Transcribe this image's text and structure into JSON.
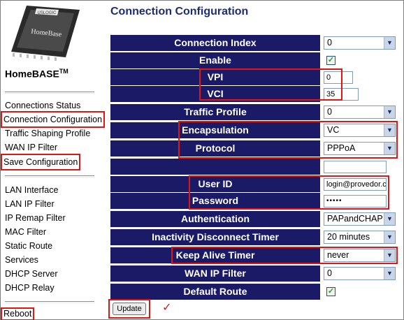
{
  "sidebar": {
    "logo_text_top": "USLOGIC",
    "logo_text_main": "HomeBase",
    "logo_tm": "™",
    "brand": "HomeBASE",
    "brand_tm": "TM",
    "items": [
      {
        "label": "Connections Status"
      },
      {
        "label": "Connection Configuration"
      },
      {
        "label": "Traffic Shaping Profile"
      },
      {
        "label": "WAN IP Filter"
      },
      {
        "label": "Save Configuration"
      },
      {
        "label": "LAN Interface"
      },
      {
        "label": "LAN IP Filter"
      },
      {
        "label": "IP Remap Filter"
      },
      {
        "label": "MAC Filter"
      },
      {
        "label": "Static Route"
      },
      {
        "label": "Services"
      },
      {
        "label": "DHCP Server"
      },
      {
        "label": "DHCP Relay"
      },
      {
        "label": "Reboot"
      }
    ]
  },
  "main": {
    "title": "Connection Configuration",
    "rows": [
      {
        "label": "Connection Index",
        "value": "0"
      },
      {
        "label": "Enable",
        "checked": "✓"
      },
      {
        "label": "VPI",
        "value": "0"
      },
      {
        "label": "VCI",
        "value": "35"
      },
      {
        "label": "Traffic Profile",
        "value": "0"
      },
      {
        "label": "Encapsulation",
        "value": "VC"
      },
      {
        "label": "Protocol",
        "value": "PPPoA"
      },
      {
        "label": "",
        "value": ""
      },
      {
        "label": "User ID",
        "value": "login@provedor.c"
      },
      {
        "label": "Password",
        "value": "•••••"
      },
      {
        "label": "Authentication",
        "value": "PAPandCHAP"
      },
      {
        "label": "Inactivity Disconnect Timer",
        "value": "20 minutes"
      },
      {
        "label": "Keep Alive Timer",
        "value": "never"
      },
      {
        "label": "WAN IP Filter",
        "value": "0"
      },
      {
        "label": "Default Route",
        "checked": "✓"
      }
    ],
    "update_label": "Update",
    "check_mark": "✓"
  },
  "icons": {
    "dropdown_arrow": "▼"
  },
  "colors": {
    "label_bg": "#1a1a66",
    "title": "#1f2c75",
    "highlight": "#e01515"
  }
}
